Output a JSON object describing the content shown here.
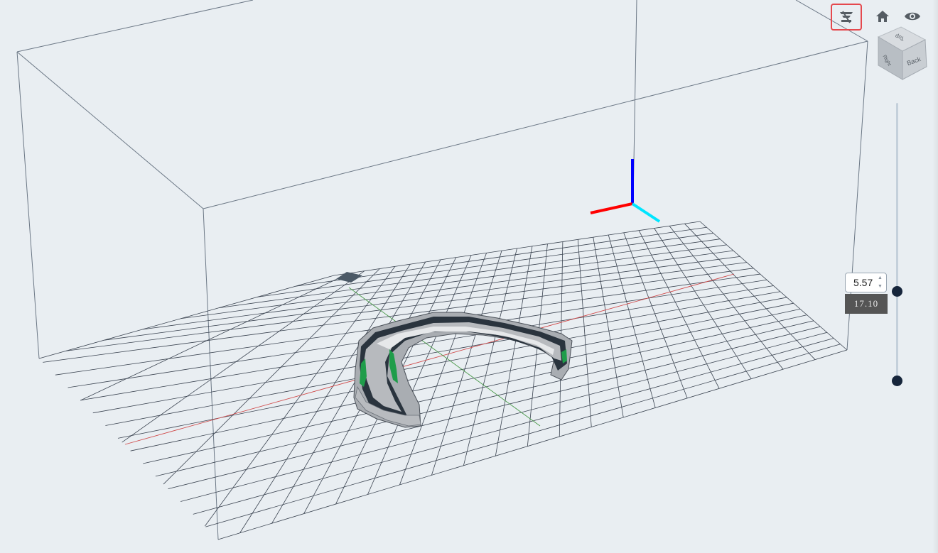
{
  "toolbar": {
    "slice_preview_icon": "layer-slice-icon",
    "home_icon": "home-icon",
    "visibility_icon": "eye-icon"
  },
  "viewcube": {
    "top_label": "Top",
    "back_label": "Back",
    "right_label": "Right"
  },
  "layer_slider": {
    "input_value": "5.57",
    "tooltip_value": "17.10"
  },
  "colors": {
    "background": "#e9eef2",
    "highlight": "#e5484d",
    "axis_x": "#ff0000",
    "axis_y": "#00e5ff",
    "axis_z": "#0000ff",
    "slider_handle": "#16253b"
  }
}
